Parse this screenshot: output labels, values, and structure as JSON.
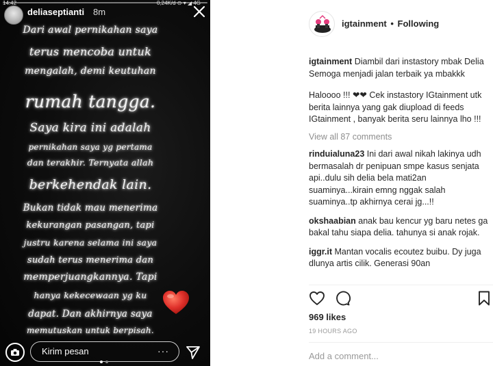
{
  "story": {
    "status_time": "14:42",
    "status_right": "0,24K/d ⊙ ▾ ◢ 4G",
    "username": "deliaseptianti",
    "time_ago": "8m",
    "lines": [
      "Dari awal pernikahan saya",
      "terus mencoba untuk",
      "mengalah, demi keutuhan",
      "rumah tangga.",
      "Saya kira ini adalah",
      "pernikahan saya yg pertama",
      "dan terakhir. Ternyata allah",
      "berkehendak lain.",
      "Bukan tidak mau menerima",
      "kekurangan pasangan, tapi",
      "justru karena selama ini saya",
      "sudah terus menerima dan",
      "memperjuangkannya. Tapi",
      "hanya kekecewaan yg ku",
      "dapat. Dan akhirnya saya",
      "memutuskan untuk berpisah."
    ],
    "reply_placeholder": "Kirim pesan",
    "reply_more": "···"
  },
  "post": {
    "account": "igtainment",
    "separator": "•",
    "follow_status": "Following",
    "caption": {
      "username": "igtainment",
      "line1": "Diambil dari instastory mbak Delia",
      "line2": "Semoga menjadi jalan terbaik ya mbakkk",
      "para2_prefix": "Haloooo !!! ",
      "hearts": "❤❤",
      "para2_rest": " Cek instastory IGtainment utk berita lainnya yang gak diupload di feeds IGtainment , banyak berita seru lainnya lho !!!"
    },
    "view_all": "View all 87 comments",
    "comments": [
      {
        "username": "rinduialuna23",
        "text": "Ini dari awal nikah lakinya udh bermasalah dr penipuan smpe kasus senjata api..dulu sih delia bela mati2an suaminya...kirain emng nggak salah suaminya..tp akhirnya cerai jg...!!"
      },
      {
        "username": "okshaabian",
        "text": "anak bau kencur yg baru netes ga bakal tahu siapa delia. tahunya si anak rojak."
      },
      {
        "username": "iggr.it",
        "text": "Mantan vocalis ecoutez buibu. Dy juga dlunya artis cilik. Generasi 90an"
      }
    ],
    "likes": "969 likes",
    "timestamp": "19 HOURS AGO",
    "add_comment_placeholder": "Add a comment..."
  },
  "colors": {
    "story_bg": "#0c0c0c",
    "story_text_glow": "#ffffff",
    "heart_red": "#e0312b",
    "text_primary": "#262626",
    "text_muted": "#8e8e8e"
  },
  "icons": {
    "close": "close-icon",
    "camera": "camera-icon",
    "send": "send-icon",
    "like": "heart-outline-icon",
    "comment": "comment-icon",
    "bookmark": "bookmark-icon"
  }
}
